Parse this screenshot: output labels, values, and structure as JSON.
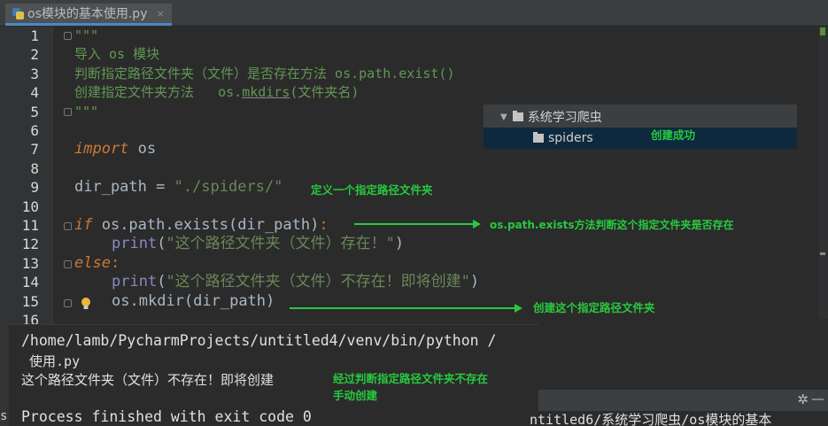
{
  "tab": {
    "title": "os模块的基本使用.py",
    "close": "×"
  },
  "line_numbers": [
    "1",
    "2",
    "3",
    "4",
    "5",
    "6",
    "7",
    "8",
    "9",
    "10",
    "11",
    "12",
    "13",
    "14",
    "15",
    "16"
  ],
  "code": {
    "l1": "\"\"\"",
    "l2": "导入 os 模块",
    "l3": "判断指定路径文件夹（文件）是否存在方法 os.path.exist()",
    "l4a": "创建指定文件夹方法   os.",
    "l4b": "mkdirs",
    "l4c": "(文件夹名)",
    "l5": "\"\"\"",
    "l7_kw": "import",
    "l7_rest": " os",
    "l9_var": "dir_path = ",
    "l9_str": "\"./spiders/\"",
    "l11_kw": "if",
    "l11_rest": " os.path.exists(dir_path)",
    "l11_colon": ":",
    "l12_fn": "print",
    "l12_open": "(",
    "l12_str": "\"这个路径文件夹（文件）存在！\"",
    "l12_close": ")",
    "l13_kw": "else",
    "l13_colon": ":",
    "l14_fn": "print",
    "l14_open": "(",
    "l14_str": "\"这个路径文件夹（文件）不存在！即将创建\"",
    "l14_close": ")",
    "l15a": "os.",
    "l15b": "mkdir",
    "l15c": "(dir_path)"
  },
  "annotations": {
    "a1": "定义一个指定路径文件夹",
    "a2": "os.path.exists方法判断这个指定文件夹是否存在",
    "a3": "创建这个指定路径文件夹",
    "a4": "创建成功",
    "a5_line1": "经过判断指定路径文件夹不存在",
    "a5_line2": "手动创建"
  },
  "tree": {
    "root": "系统学习爬虫",
    "child": "spiders"
  },
  "console": {
    "line1": "/home/lamb/PycharmProjects/untitled4/venv/bin/python /",
    "line2": " 使用.py",
    "line3": "这个路径文件夹（文件）不存在！即将创建",
    "line4": "Process finished with exit code 0"
  },
  "status": {
    "path": "ntitled6/系统学习爬虫/os模块的基本",
    "gear": "✲",
    "minus": "—",
    "sliver": "s"
  },
  "colors": {
    "annotation": "#27c93f",
    "keyword": "#cc7832",
    "string": "#6a8759",
    "comment": "#629755",
    "builtin": "#8888c6"
  },
  "icons": {
    "bulb": "lightbulb-icon",
    "folder": "folder-icon",
    "python_file": "python-file-icon"
  }
}
